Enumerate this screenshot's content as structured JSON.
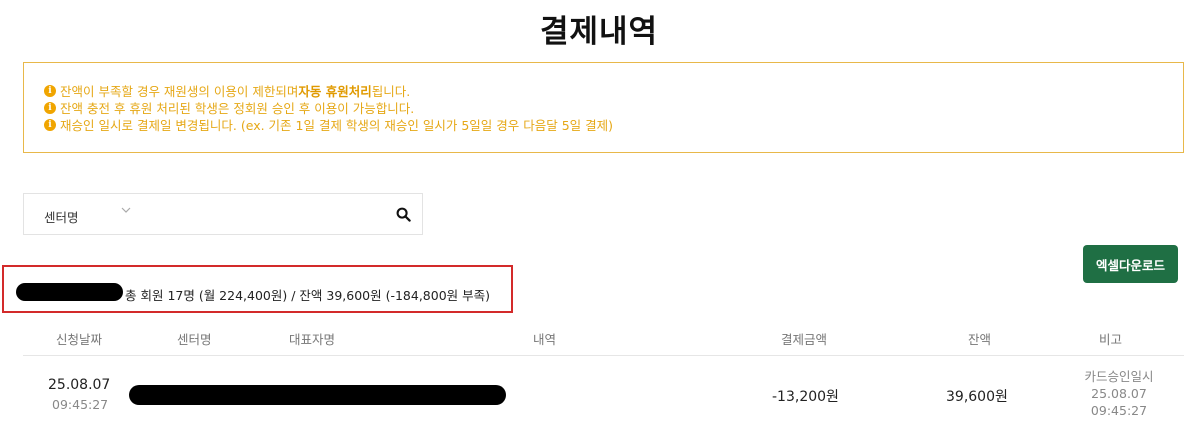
{
  "page": {
    "title": "결제내역"
  },
  "notice": {
    "lines": [
      {
        "prefix": "잔액이 부족할 경우 재원생의 이용이 제한되며 ",
        "bold": "자동 휴원처리",
        "suffix": " 됩니다."
      },
      {
        "prefix": "잔액 충전 후 휴원 처리된 학생은 정회원 승인 후 이용이 가능합니다.",
        "bold": "",
        "suffix": ""
      },
      {
        "prefix": "재승인 일시로 결제일 변경됩니다. (ex. 기존 1일 결제 학생의 재승인 일시가 5일일 경우 다음달 5일 결제)",
        "bold": "",
        "suffix": ""
      }
    ],
    "icon": "info-circle-icon",
    "color": "#e6a817"
  },
  "search": {
    "select_value": "센터명",
    "select_icon": "chevron-down-icon",
    "search_icon": "search-icon"
  },
  "excel_button": {
    "label": "엑셀다운로드",
    "color": "#1f6f44"
  },
  "summary": {
    "text": "총 회원 17명 (월 224,400원) / 잔액 39,600원 (-184,800원 부족)",
    "highlight_color": "#d32a2a"
  },
  "table": {
    "headers": [
      "신청날짜",
      "센터명",
      "대표자명",
      "내역",
      "결제금액",
      "잔액",
      "비고"
    ],
    "rows": [
      {
        "date": "25.08.07",
        "time": "09:45:27",
        "amount": "-13,200원",
        "balance": "39,600원",
        "remark_title": "카드승인일시",
        "remark_date": "25.08.07",
        "remark_time": "09:45:27"
      }
    ]
  }
}
